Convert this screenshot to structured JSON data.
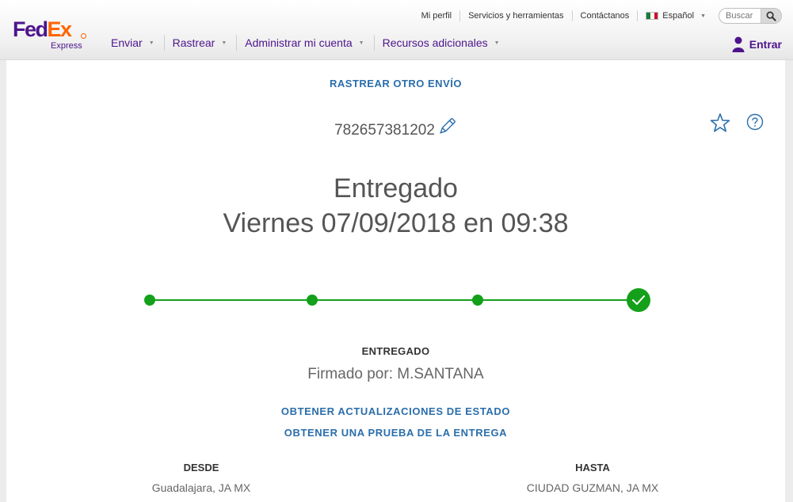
{
  "brand": {
    "name_part1": "Fed",
    "name_part2": "Ex",
    "sub": "Express"
  },
  "utility_nav": {
    "profile": "Mi perfil",
    "services": "Servicios y herramientas",
    "contact": "Contáctanos",
    "language": "Español",
    "search_placeholder": "Buscar"
  },
  "main_nav": {
    "items": [
      {
        "label": "Enviar"
      },
      {
        "label": "Rastrear"
      },
      {
        "label": "Administrar mi cuenta"
      },
      {
        "label": "Recursos adicionales"
      }
    ],
    "login": "Entrar"
  },
  "tracking": {
    "track_another": "RASTREAR OTRO ENVÍO",
    "number": "782657381202",
    "status": "Entregado",
    "status_date": "Viernes 07/09/2018 en 09:38",
    "progress": {
      "steps_total": 4,
      "steps_completed": 4
    },
    "status_label": "ENTREGADO",
    "signed_by": "Firmado por: M.SANTANA",
    "link_updates": "OBTENER ACTUALIZACIONES DE ESTADO",
    "link_proof": "OBTENER UNA PRUEBA DE LA ENTREGA",
    "from_label": "DESDE",
    "from_value": "Guadalajara, JA MX",
    "to_label": "HASTA",
    "to_value": "CIUDAD GUZMAN, JA MX"
  },
  "colors": {
    "brand_purple": "#4d148c",
    "brand_orange": "#ff6600",
    "link_blue": "#2a6eab",
    "progress_green": "#14a01a"
  },
  "icons": [
    "search-icon",
    "user-icon",
    "pencil-icon",
    "star-icon",
    "help-icon",
    "check-icon",
    "mexico-flag-icon"
  ]
}
